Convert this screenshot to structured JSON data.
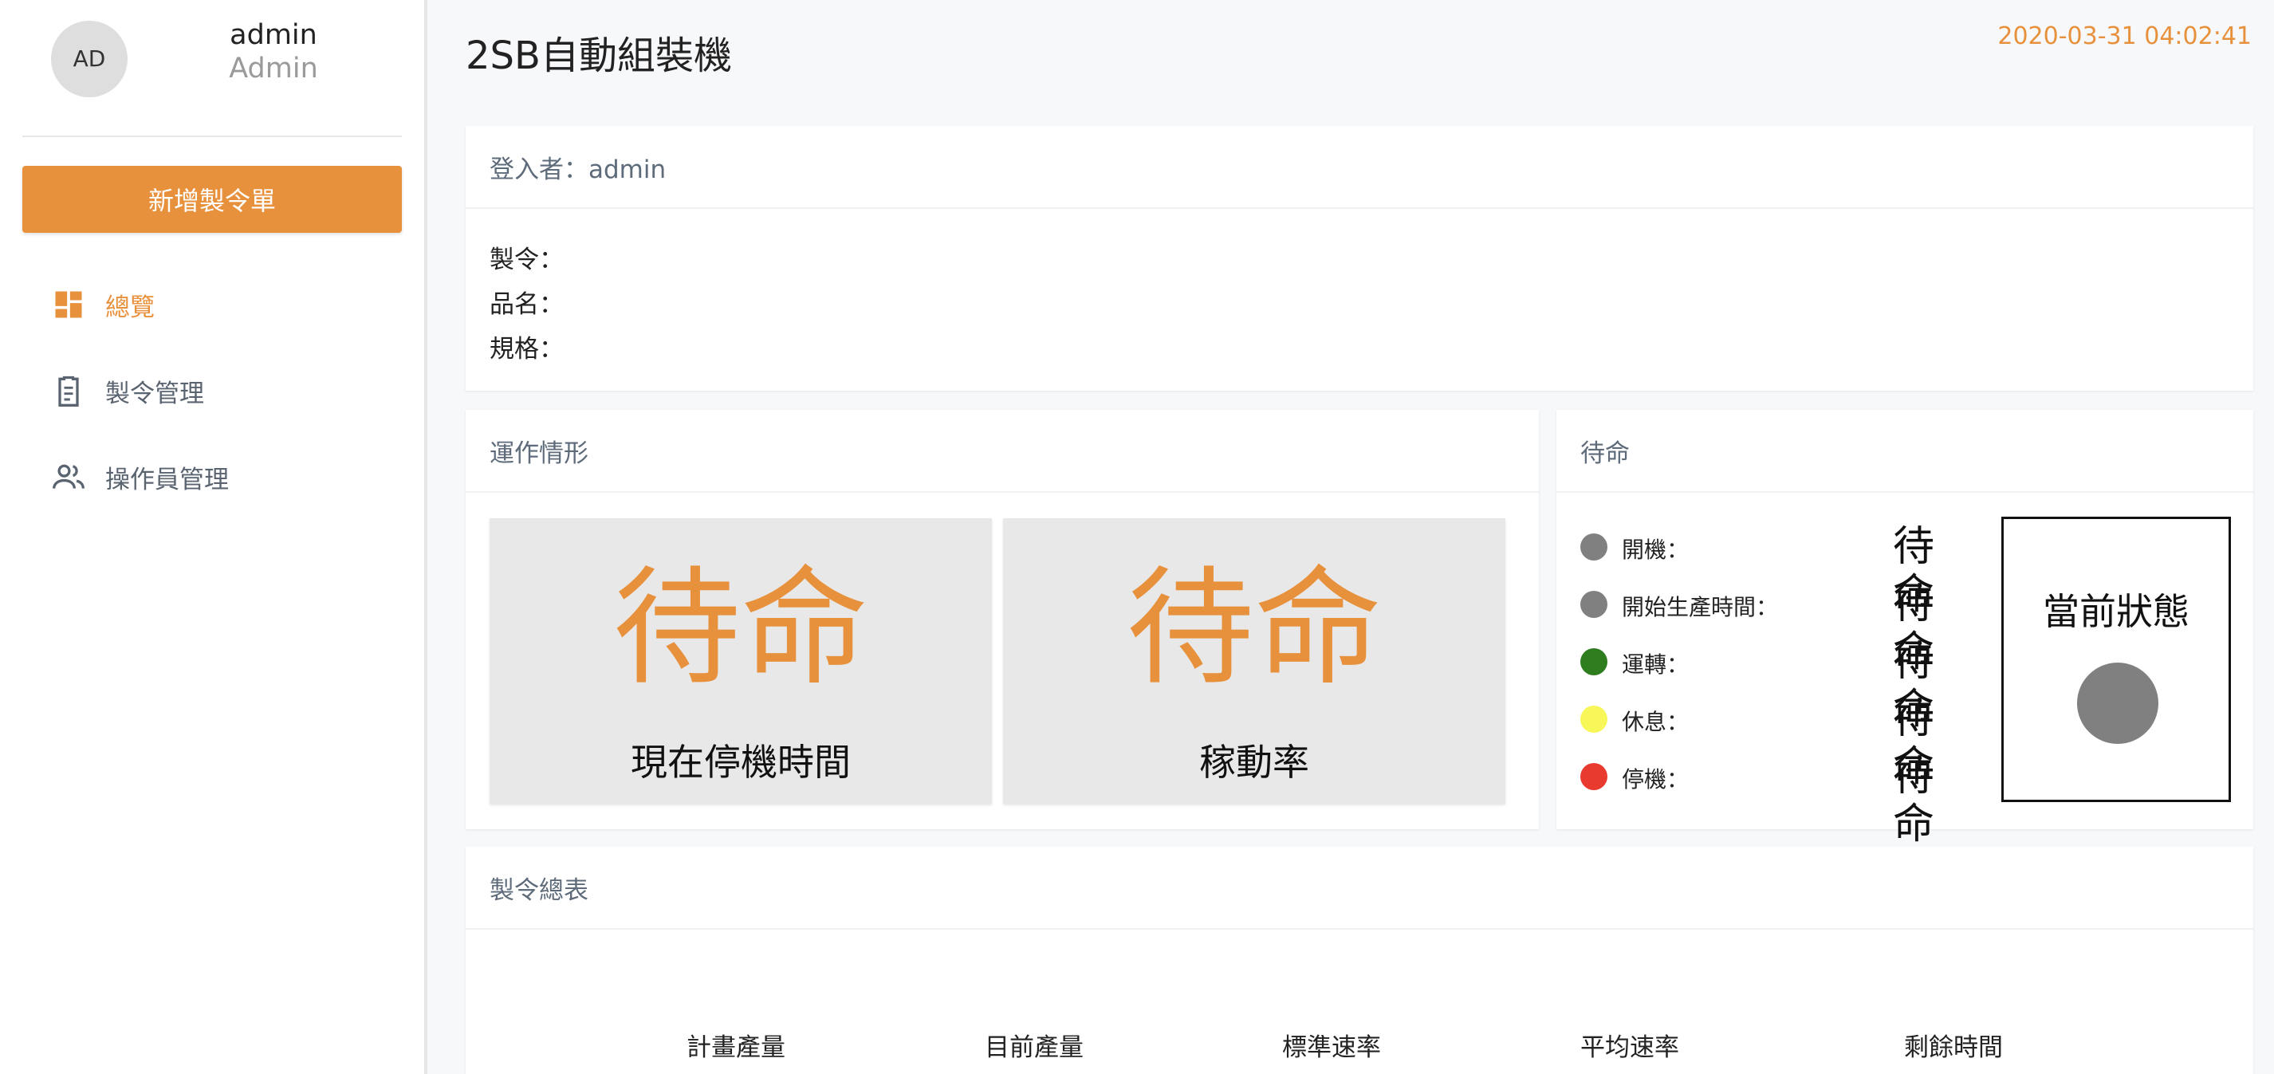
{
  "sidebar": {
    "avatar_initials": "AD",
    "user_name": "admin",
    "user_role": "Admin",
    "new_order_button": "新增製令單",
    "nav": [
      {
        "label": "總覽",
        "icon": "dashboard-icon",
        "active": true
      },
      {
        "label": "製令管理",
        "icon": "clipboard-icon",
        "active": false
      },
      {
        "label": "操作員管理",
        "icon": "users-icon",
        "active": false
      }
    ]
  },
  "header": {
    "title": "2SB自動組裝機",
    "datetime": "2020-03-31 04:02:41"
  },
  "login_card": {
    "header": "登入者：admin",
    "lines": [
      "製令：",
      "品名：",
      "規格："
    ]
  },
  "operation_card": {
    "header": "運作情形",
    "stats": [
      {
        "value": "待命",
        "label": "現在停機時間"
      },
      {
        "value": "待命",
        "label": "稼動率"
      }
    ]
  },
  "status_card": {
    "header": "待命",
    "rows": [
      {
        "label": "開機：",
        "value": "待命",
        "color": "#808080"
      },
      {
        "label": "開始生產時間：",
        "value": "待命",
        "color": "#808080"
      },
      {
        "label": "運轉：",
        "value": "待命",
        "color": "#2e7d1f"
      },
      {
        "label": "休息：",
        "value": "待命",
        "color": "#f7f75a"
      },
      {
        "label": "停機：",
        "value": "待命",
        "color": "#e83a2e"
      }
    ],
    "current_state_label": "當前狀態",
    "current_state_color": "#808080"
  },
  "summary_card": {
    "header": "製令總表",
    "columns": [
      "計畫產量",
      "目前產量",
      "標準速率",
      "平均速率",
      "剩餘時間"
    ]
  },
  "colors": {
    "accent": "#e8913d",
    "sidebar_bg": "#ffffff",
    "page_bg": "#f7f8fa"
  }
}
